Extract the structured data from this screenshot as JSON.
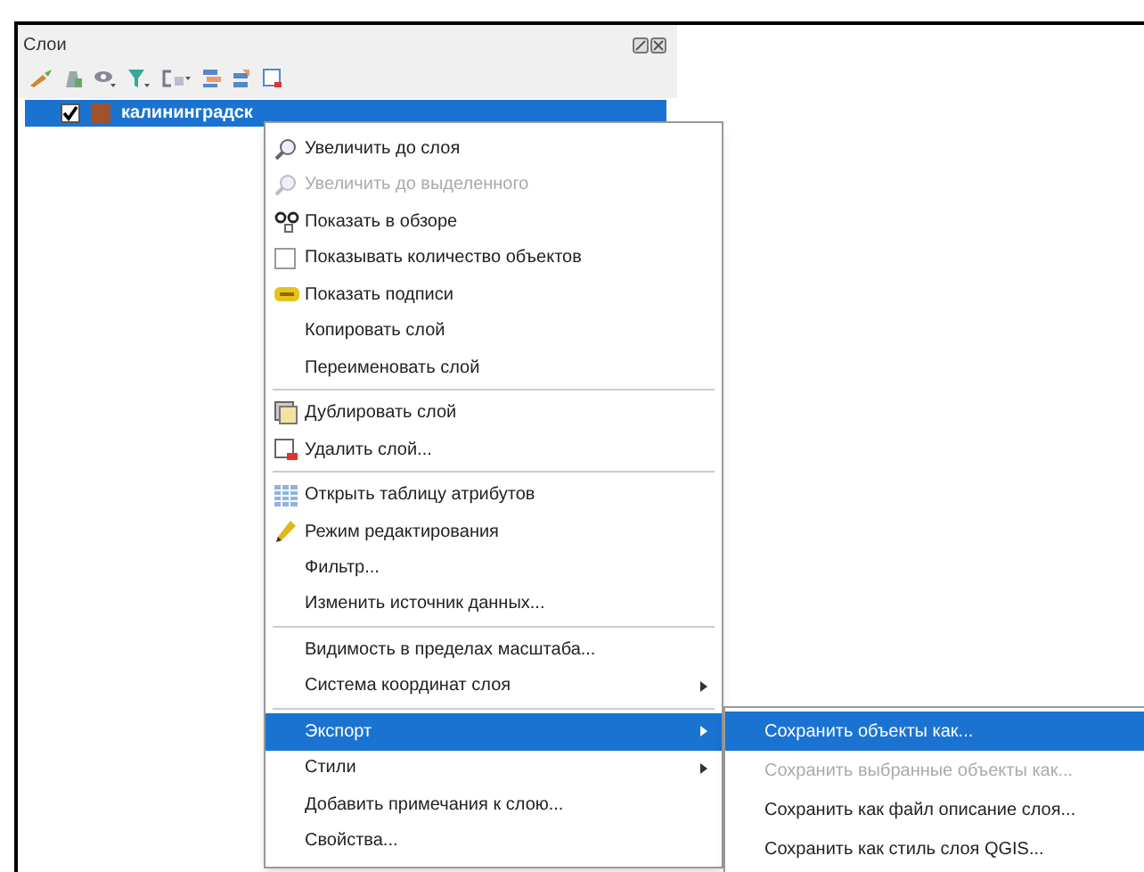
{
  "panel": {
    "title": "Слои"
  },
  "layers": [
    {
      "name": "калининградск",
      "checked": true,
      "selected": true,
      "color": "#a0522d"
    }
  ],
  "menu": [
    {
      "kind": "zoom",
      "label": "Увеличить до слоя",
      "disabled": false,
      "selected": false
    },
    {
      "kind": "zoom",
      "label": "Увеличить до выделенного",
      "disabled": true,
      "selected": false
    },
    {
      "kind": "overview",
      "label": "Показать в обзоре",
      "disabled": false,
      "selected": false
    },
    {
      "kind": "checkbox",
      "label": "Показывать количество объектов",
      "checked": false,
      "disabled": false,
      "selected": false
    },
    {
      "kind": "labels",
      "label": "Показать подписи",
      "disabled": false,
      "selected": false
    },
    {
      "kind": "plain",
      "label": "Копировать слой",
      "disabled": false,
      "selected": false
    },
    {
      "kind": "plain",
      "label": "Переименовать слой",
      "disabled": false,
      "selected": false
    },
    {
      "kind": "separator"
    },
    {
      "kind": "duplicate",
      "label": "Дублировать слой",
      "disabled": false,
      "selected": false
    },
    {
      "kind": "delete",
      "label": "Удалить слой...",
      "disabled": false,
      "selected": false
    },
    {
      "kind": "separator"
    },
    {
      "kind": "table",
      "label": "Открыть таблицу атрибутов",
      "disabled": false,
      "selected": false
    },
    {
      "kind": "pencil",
      "label": "Режим редактирования",
      "disabled": false,
      "selected": false
    },
    {
      "kind": "plain",
      "label": "Фильтр...",
      "disabled": false,
      "selected": false
    },
    {
      "kind": "plain",
      "label": "Изменить источник данных...",
      "disabled": false,
      "selected": false
    },
    {
      "kind": "separator"
    },
    {
      "kind": "plain",
      "label": "Видимость в пределах масштаба...",
      "disabled": false,
      "selected": false
    },
    {
      "kind": "submenu",
      "label": "Система координат слоя",
      "disabled": false,
      "selected": false
    },
    {
      "kind": "separator"
    },
    {
      "kind": "submenu",
      "label": "Экспорт",
      "disabled": false,
      "selected": true
    },
    {
      "kind": "submenu",
      "label": "Стили",
      "disabled": false,
      "selected": false
    },
    {
      "kind": "plain",
      "label": "Добавить примечания к слою...",
      "disabled": false,
      "selected": false
    },
    {
      "kind": "plain",
      "label": "Свойства...",
      "disabled": false,
      "selected": false
    }
  ],
  "submenu": [
    {
      "label": "Сохранить объекты как...",
      "disabled": false,
      "selected": true
    },
    {
      "label": "Сохранить выбранные объекты как...",
      "disabled": true,
      "selected": false
    },
    {
      "label": "Сохранить как файл описание слоя...",
      "disabled": false,
      "selected": false
    },
    {
      "label": "Сохранить как стиль слоя QGIS...",
      "disabled": false,
      "selected": false
    }
  ]
}
